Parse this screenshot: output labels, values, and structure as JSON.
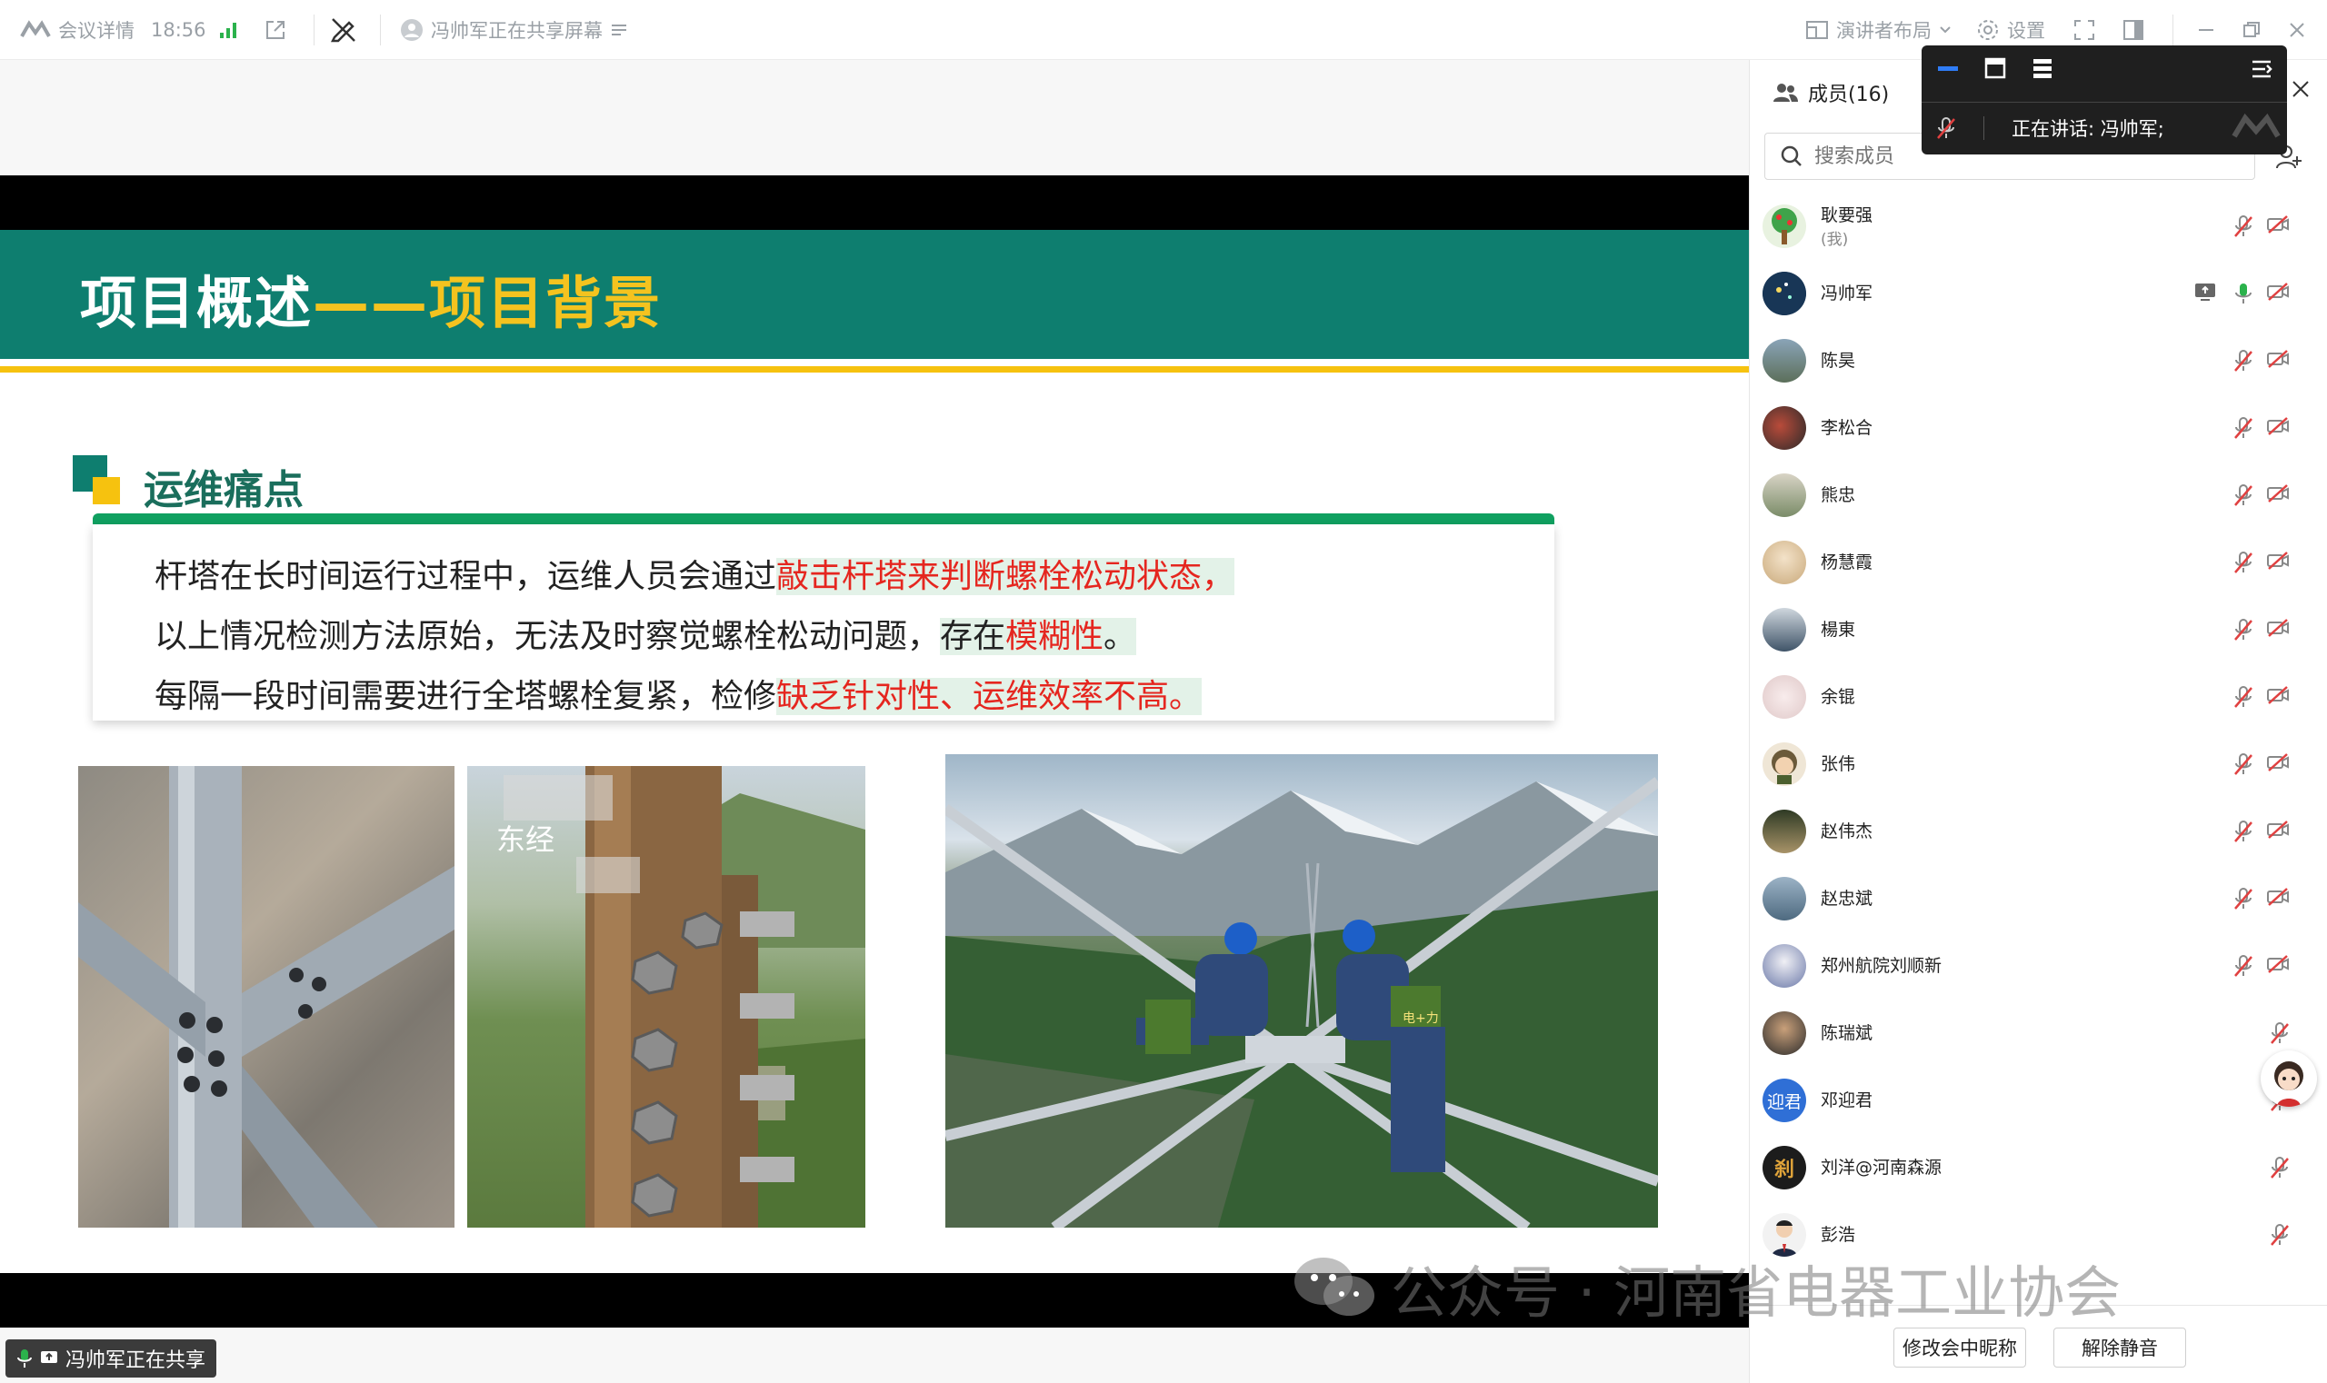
{
  "topbar": {
    "meeting_info": "会议详情",
    "time": "18:56",
    "sharing_status": "冯帅军正在共享屏幕",
    "layout_label": "演讲者布局",
    "settings_label": "设置"
  },
  "slide": {
    "title_main": "项目概述",
    "title_dash": "——",
    "title_highlight": "项目背景",
    "section_title": "运维痛点",
    "line1_a": "杆塔在长时间运行过程中，运维人员会通过",
    "line1_b": "敲击杆塔来判断螺栓松动状态，",
    "line2_a": "以上情况检测方法原始，无法及时察觉螺栓松动问题，",
    "line2_b": "存在",
    "line2_c": "模糊性",
    "line2_d": "。",
    "line3_a": "每隔一段时间需要进行全塔螺栓复紧，检修",
    "line3_b": "缺乏针对性、运维效率不高。",
    "photo2_label": "东经",
    "photo3_badge": "电+力"
  },
  "share_badge": "冯帅军正在共享",
  "panel": {
    "members_label": "成员(16)",
    "search_placeholder": "搜索成员",
    "members": [
      {
        "name": "耿要强",
        "sub": "(我)"
      },
      {
        "name": "冯帅军",
        "sub": ""
      },
      {
        "name": "陈昊",
        "sub": ""
      },
      {
        "name": "李松合",
        "sub": ""
      },
      {
        "name": "熊忠",
        "sub": ""
      },
      {
        "name": "杨慧霞",
        "sub": ""
      },
      {
        "name": "楊東",
        "sub": ""
      },
      {
        "name": "余锟",
        "sub": ""
      },
      {
        "name": "张伟",
        "sub": ""
      },
      {
        "name": "赵伟杰",
        "sub": ""
      },
      {
        "name": "赵忠斌",
        "sub": ""
      },
      {
        "name": "郑州航院刘顺新",
        "sub": ""
      },
      {
        "name": "陈瑞斌",
        "sub": ""
      },
      {
        "name": "邓迎君",
        "sub": ""
      },
      {
        "name": "刘洋@河南森源",
        "sub": ""
      },
      {
        "name": "彭浩",
        "sub": ""
      }
    ],
    "avatar_text_dengyingjun": "迎君",
    "avatar_text_liuyang": "刹",
    "rename_button": "修改会中昵称",
    "unmute_button": "解除静音"
  },
  "float": {
    "speaking_label": "正在讲话:",
    "speaking_name": "冯帅军;"
  },
  "watermark": "公众号 · 河南省电器工业协会",
  "colors": {
    "header_teal": "#0e7e6f",
    "title_yellow": "#f4c31f",
    "accent_red": "#e5261f",
    "mic_green": "#2bb24c",
    "muted_red": "#e04040"
  }
}
